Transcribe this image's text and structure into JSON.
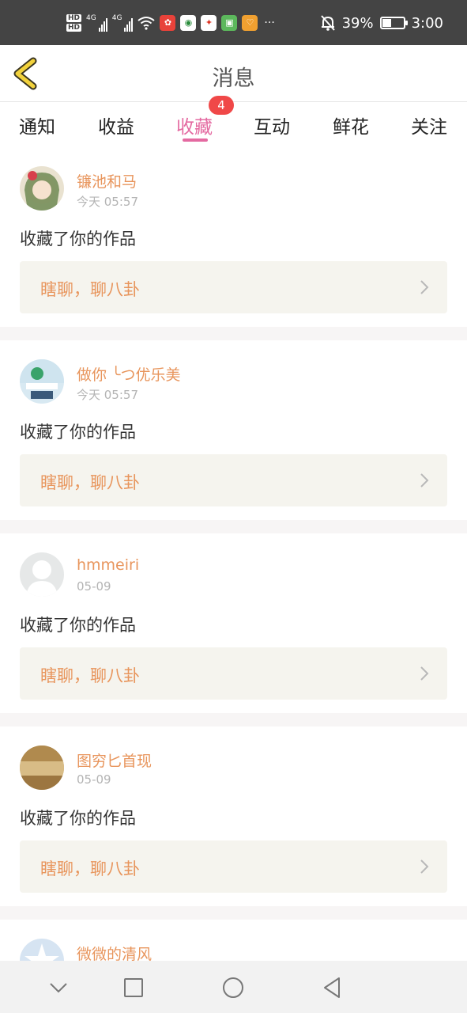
{
  "status_bar": {
    "hd_1": "HD",
    "hd_2": "HD",
    "net_1": "4G",
    "net_2": "4G",
    "more": "···",
    "battery": "39%",
    "time": "3:00",
    "icons": [
      "wifi-icon",
      "app-icon-1",
      "app-icon-2",
      "app-icon-3",
      "app-icon-4",
      "app-icon-5",
      "mute-bell-icon",
      "battery-icon"
    ]
  },
  "header": {
    "title": "消息",
    "back_icon": "chevron-left-icon"
  },
  "tabs": [
    {
      "label": "通知"
    },
    {
      "label": "收益"
    },
    {
      "label": "收藏",
      "badge": "4",
      "active": true
    },
    {
      "label": "互动"
    },
    {
      "label": "鲜花"
    },
    {
      "label": "关注"
    }
  ],
  "messages": [
    {
      "user": "镰池和马",
      "time": "今天 05:57",
      "action": "收藏了你的作品",
      "work": "瞎聊，聊八卦"
    },
    {
      "user": "做你 ╰つ优乐美",
      "time": "今天 05:57",
      "action": "收藏了你的作品",
      "work": "瞎聊，聊八卦"
    },
    {
      "user": "hmmeiri",
      "time": "05-09",
      "action": "收藏了你的作品",
      "work": "瞎聊，聊八卦"
    },
    {
      "user": "图穷匕首现",
      "time": "05-09",
      "action": "收藏了你的作品",
      "work": "瞎聊，聊八卦"
    },
    {
      "user": "微微的清风"
    }
  ],
  "colors": {
    "accent": "#e46aa1",
    "name": "#e8955c",
    "badge": "#f04848",
    "work_bg": "#f5f4ee",
    "status_bar": "#444444"
  },
  "nav_bar": {
    "icons": [
      "chevron-down-icon",
      "recent-apps-icon",
      "home-icon",
      "back-icon"
    ]
  }
}
